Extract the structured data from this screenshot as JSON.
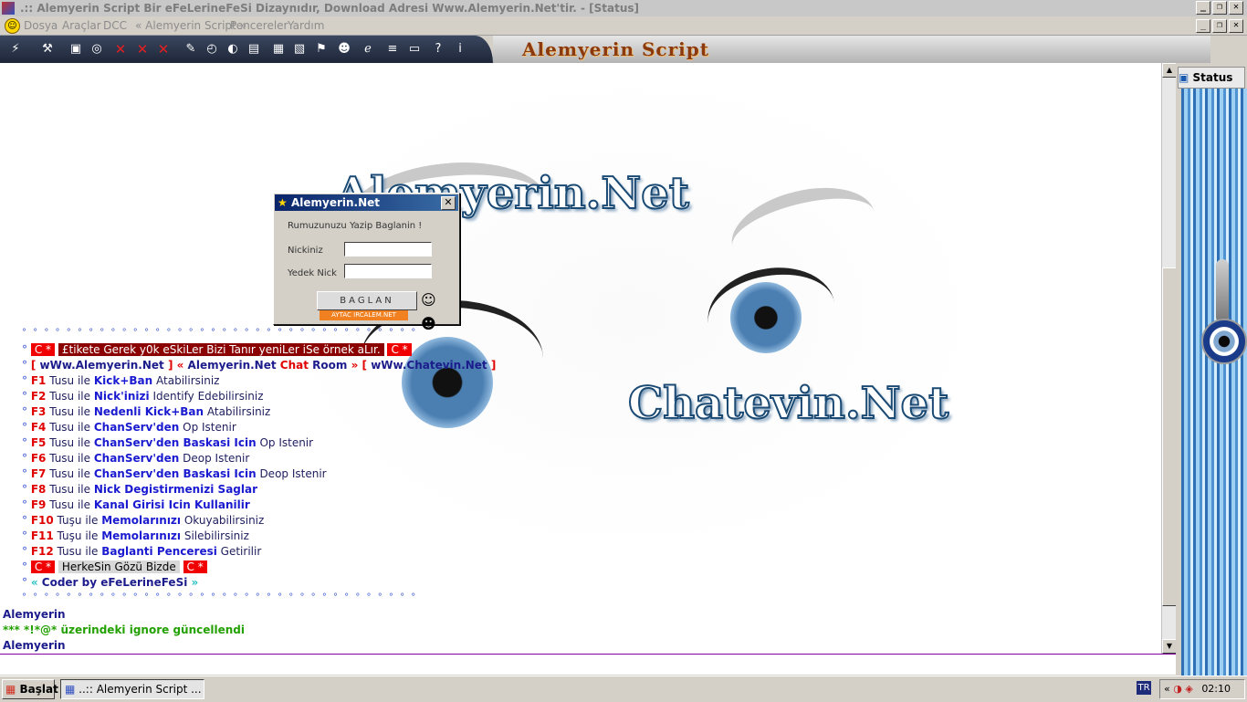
{
  "window": {
    "title": ".:: Alemyerin Script Bir eFeLerineFeSi Dizaynıdır, Download Adresi Www.Alemyerin.Net'tir. - [Status]"
  },
  "menu": {
    "items": [
      "Dosya",
      "Araçlar",
      "DCC",
      "« Alemyerin Script »",
      "Pencereler",
      "Yardım"
    ]
  },
  "toolbar": {
    "brand": "Alemyerin Script",
    "icons": [
      "connect-icon",
      "options-icon",
      "folder-icon",
      "search-icon",
      "close-icon",
      "close-icon",
      "close-icon",
      "note-icon",
      "clock-icon",
      "globe-icon",
      "book-icon",
      "window-icon",
      "network-icon",
      "pin-icon",
      "user-icon",
      "ie-icon",
      "list-icon",
      "window2-icon",
      "help-icon",
      "info-icon"
    ]
  },
  "background": {
    "text1": "Alemyerin.Net",
    "text2": "Chatevin.Net"
  },
  "chat": {
    "dots": "° ° ° ° ° ° ° ° ° ° ° ° ° ° ° ° ° ° ° ° ° ° ° ° ° ° ° ° ° ° ° ° ° ° ° °",
    "deg": "°",
    "cstar": "C *",
    "motto": "£tikete Gerek y0k eSkiLer Bizi Tanır yeniLer iSe örnek aLır.",
    "links": {
      "open": "[ ",
      "site1": "wWw.Alemyerin.Net",
      "close1": " ] « ",
      "room_a": "Alemyerin.Net",
      "room_b": " Chat",
      "room_c": " Room",
      "close2": " » [ ",
      "site2": "wWw.Chatevin.Net",
      "close3": " ]"
    },
    "keys": [
      {
        "key": "F1",
        "mid": " Tusu ile ",
        "action": "Kick+Ban",
        "tail": "  Atabilirsiniz"
      },
      {
        "key": "F2",
        "mid": " Tusu ile ",
        "action": "Nick'inizi",
        "tail": "  Identify Edebilirsiniz"
      },
      {
        "key": "F3",
        "mid": " Tusu ile ",
        "action": "Nedenli Kick+Ban",
        "tail": " Atabilirsiniz"
      },
      {
        "key": "F4",
        "mid": " Tusu ile ",
        "action": "ChanServ'den",
        "tail": " Op Istenir"
      },
      {
        "key": "F5",
        "mid": " Tusu ile ",
        "action": "ChanServ'den Baskasi Icin",
        "tail": " Op Istenir"
      },
      {
        "key": "F6",
        "mid": " Tusu ile ",
        "action": "ChanServ'den",
        "tail": "  Deop Istenir"
      },
      {
        "key": "F7",
        "mid": " Tusu ile ",
        "action": "ChanServ'den Baskasi Icin",
        "tail": "  Deop Istenir"
      },
      {
        "key": "F8",
        "mid": " Tusu ile ",
        "action": "Nick Degistirmenizi Saglar",
        "tail": ""
      },
      {
        "key": "F9",
        "mid": " Tusu ile ",
        "action": "Kanal Girisi Icin Kullanilir",
        "tail": ""
      },
      {
        "key": "F10",
        "mid": " Tuşu ile ",
        "action": "Memolarınızı",
        "tail": " Okuyabilirsiniz"
      },
      {
        "key": "F11",
        "mid": " Tuşu ile ",
        "action": "Memolarınızı",
        "tail": " Silebilirsiniz"
      },
      {
        "key": "F12",
        "mid": " Tusu ile ",
        "action": "Baglanti Penceresi",
        "tail": "  Getirilir"
      }
    ],
    "slogan": "HerkeSin Gözü Bizde",
    "coder_open": "« ",
    "coder": "Coder by eFeLerineFeSi",
    "coder_close": " »",
    "nick1": "Alemyerin",
    "ignore_msg": "*** *!*@* üzerindeki ignore güncellendi",
    "nick2": "Alemyerin"
  },
  "dialog": {
    "title": "Alemyerin.Net",
    "prompt": "Rumuzunuzu Yazip Baglanin !",
    "nick_label": "Nickiniz",
    "nick_value": "",
    "alt_label": "Yedek Nick",
    "alt_value": "",
    "connect": "BAGLAN",
    "banner": "AYTAC IRCALEM.NET"
  },
  "sidepanel": {
    "status_tab": "Status"
  },
  "taskbar": {
    "start": "Başlat",
    "task": "..:: Alemyerin Script ...",
    "lang": "TR",
    "tray_arrow": "«",
    "time": "02:10"
  },
  "colors": {
    "accent": "#0a246a",
    "nick": "#1c1c8c",
    "key_red": "#e00000",
    "action_blue": "#1a1ad0",
    "ignore_green": "#22a000"
  }
}
